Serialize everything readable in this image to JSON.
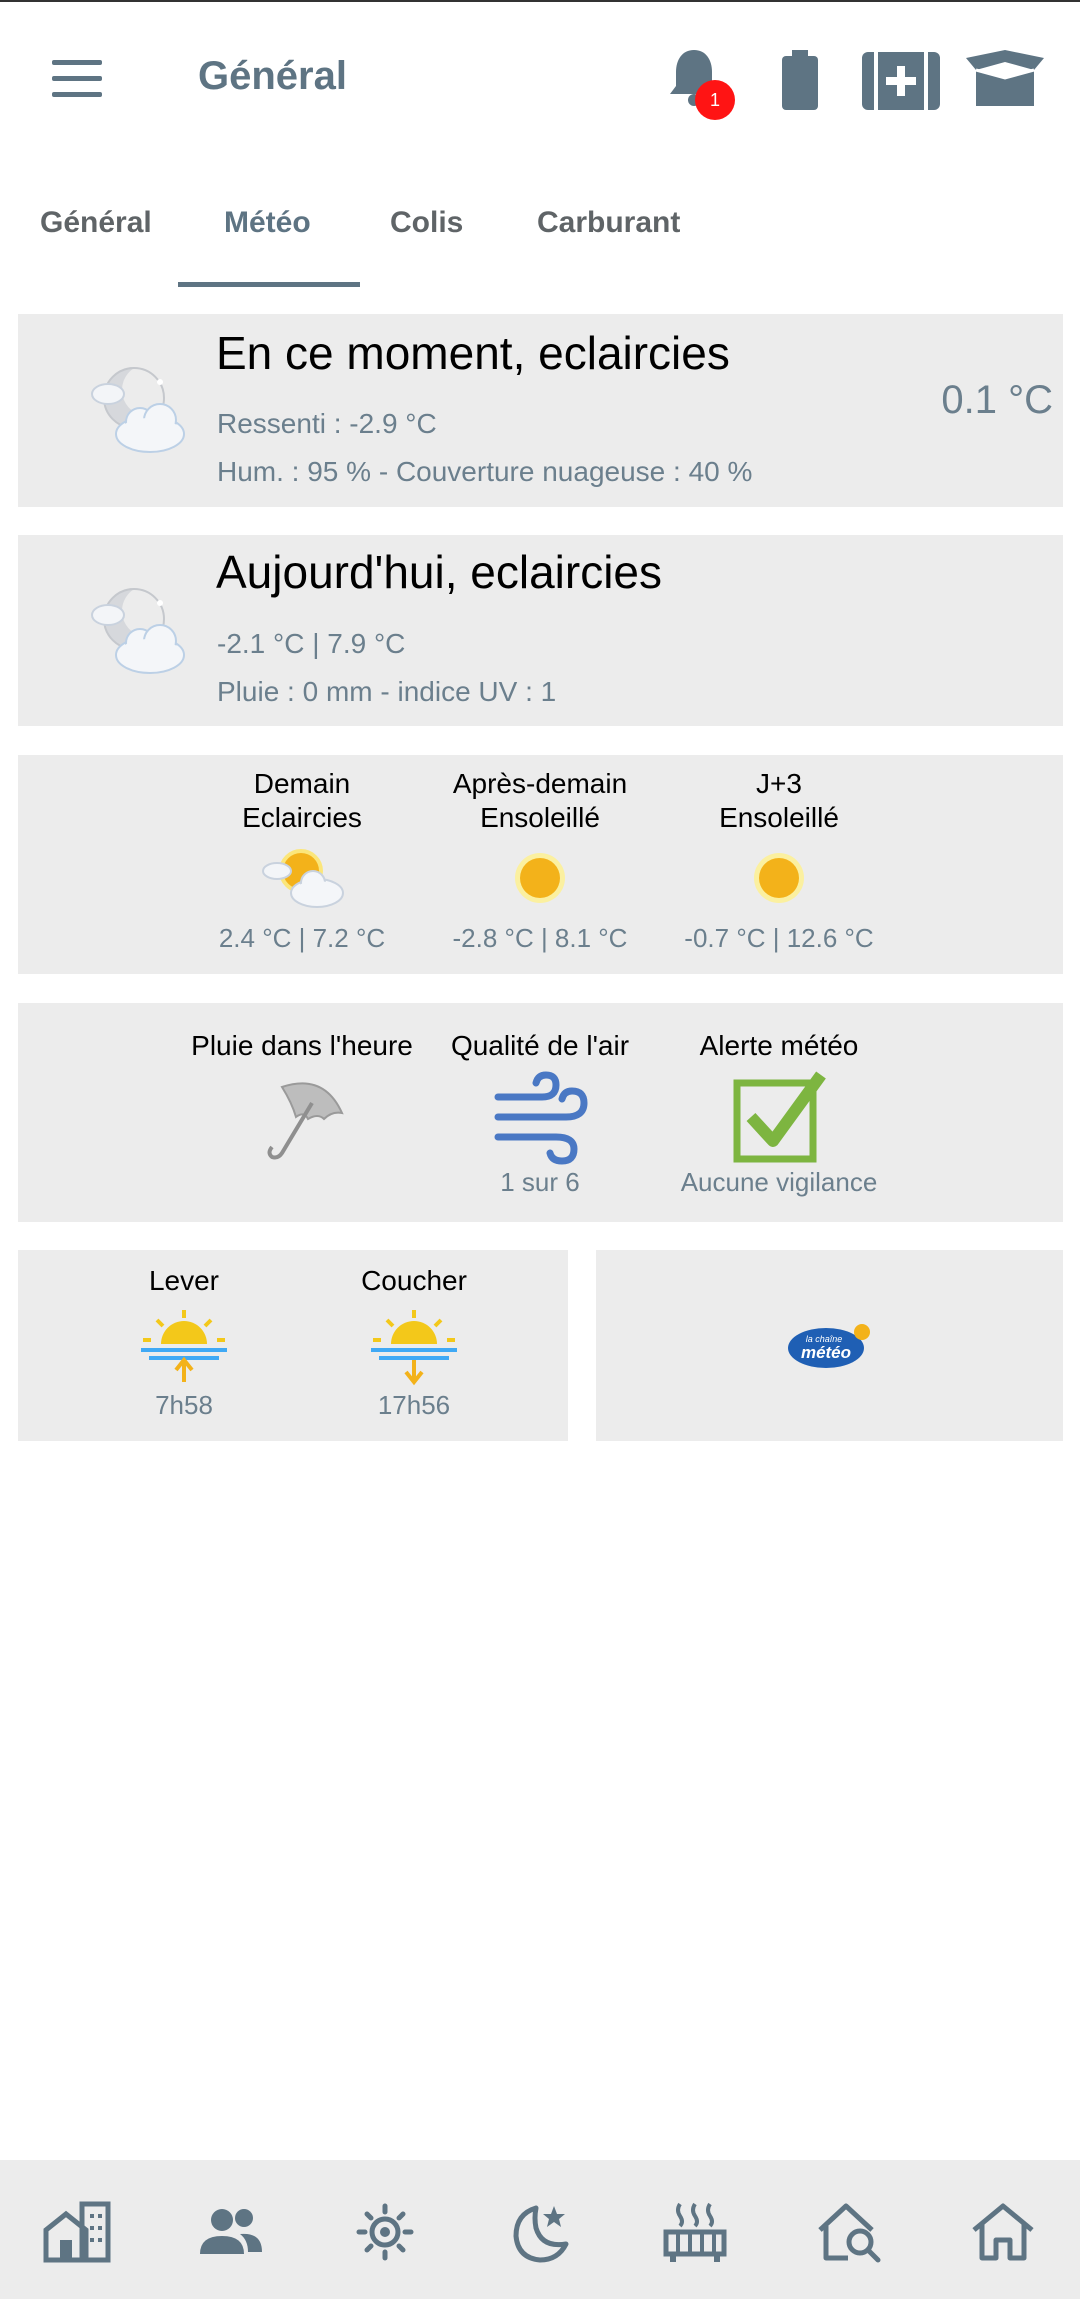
{
  "app": {
    "title": "Général",
    "notification_count": "1"
  },
  "tabs": [
    {
      "label": "Général",
      "active": false
    },
    {
      "label": "Météo",
      "active": true
    },
    {
      "label": "Colis",
      "active": false
    },
    {
      "label": "Carburant",
      "active": false
    }
  ],
  "now": {
    "title": "En ce moment, eclaircies",
    "felt": "Ressenti : -2.9 °C",
    "details": "Hum. : 95 % - Couverture nuageuse : 40 %",
    "temperature": "0.1 °C",
    "icon": "moon-cloud-icon"
  },
  "today": {
    "title": "Aujourd'hui, eclaircies",
    "range": "-2.1 °C | 7.9 °C",
    "details": "Pluie : 0 mm - indice UV : 1",
    "icon": "moon-cloud-icon"
  },
  "forecast": [
    {
      "day": "Demain",
      "condition": "Eclaircies",
      "range": "2.4 °C | 7.2 °C",
      "icon": "sun-cloud-icon"
    },
    {
      "day": "Après-demain",
      "condition": "Ensoleillé",
      "range": "-2.8 °C | 8.1 °C",
      "icon": "sun-icon"
    },
    {
      "day": "J+3",
      "condition": "Ensoleillé",
      "range": "-0.7 °C | 12.6 °C",
      "icon": "sun-icon"
    }
  ],
  "status": [
    {
      "label": "Pluie dans l'heure",
      "value": "",
      "icon": "umbrella-icon"
    },
    {
      "label": "Qualité de l'air",
      "value": "1 sur 6",
      "icon": "wind-icon"
    },
    {
      "label": "Alerte météo",
      "value": "Aucune vigilance",
      "icon": "checkbox-icon"
    }
  ],
  "sun": {
    "sunrise_label": "Lever",
    "sunrise_time": "7h58",
    "sunset_label": "Coucher",
    "sunset_time": "17h56"
  },
  "provider_logo": {
    "line1": "la chaîne",
    "line2": "météo"
  },
  "colors": {
    "accent": "#5e7483",
    "card_bg": "#ececec",
    "muted_text": "#6b7f8d",
    "sun": "#f3b21a",
    "badge": "#ff1414",
    "check": "#7db540",
    "wind": "#4a78c4"
  },
  "bottom_nav": [
    {
      "icon": "buildings-icon"
    },
    {
      "icon": "people-icon"
    },
    {
      "icon": "brightness-icon"
    },
    {
      "icon": "moon-star-icon"
    },
    {
      "icon": "heater-icon"
    },
    {
      "icon": "home-search-icon"
    },
    {
      "icon": "home-icon"
    }
  ]
}
